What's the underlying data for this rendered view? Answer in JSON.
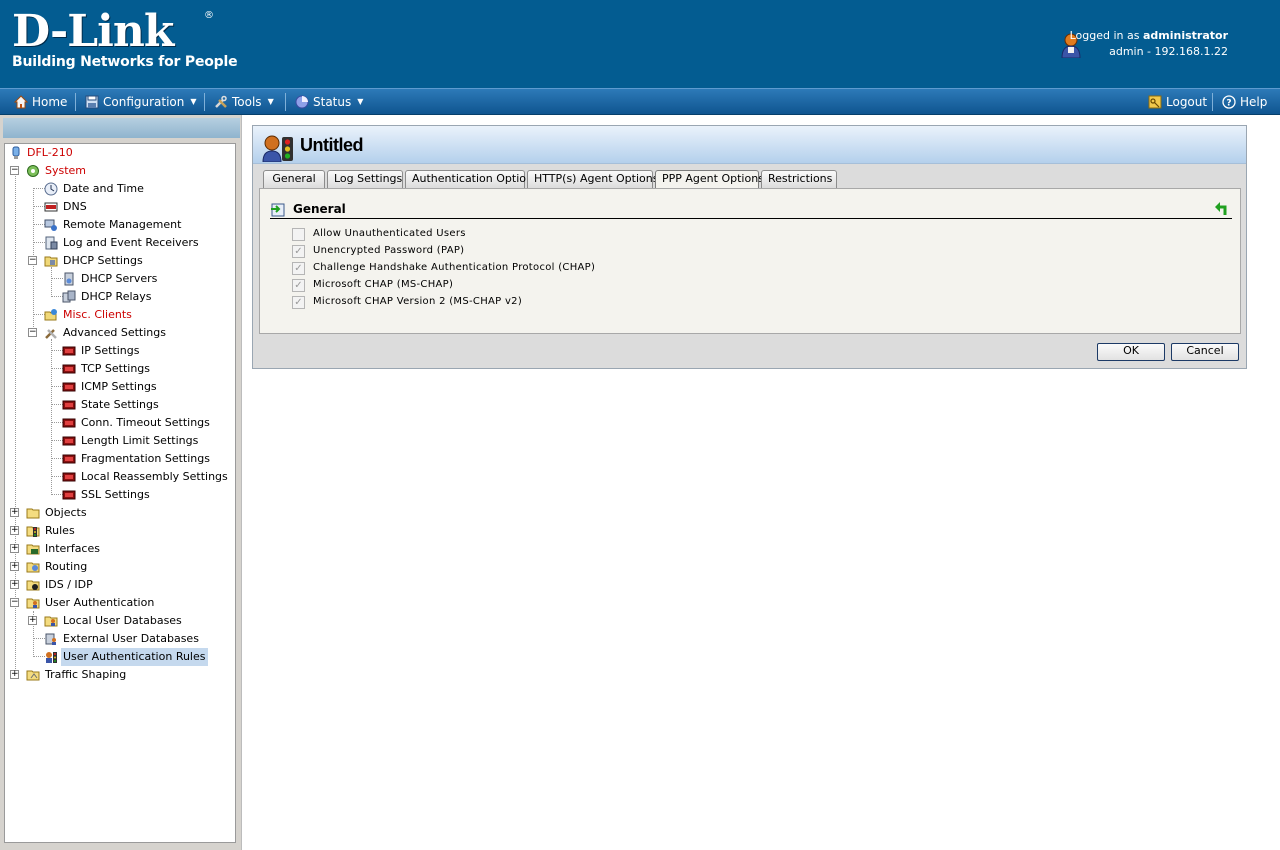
{
  "header": {
    "logo_text": "D-Link",
    "logo_reg": "®",
    "tagline": "Building Networks for People",
    "login_prefix": "Logged in as",
    "login_user": "administrator",
    "session": "admin - 192.168.1.22"
  },
  "menu": {
    "home": "Home",
    "configuration": "Configuration",
    "tools": "Tools",
    "status": "Status",
    "logout": "Logout",
    "help": "Help",
    "caret": "▼"
  },
  "tree": {
    "device": "DFL-210",
    "system": "System",
    "date_time": "Date and Time",
    "dns": "DNS",
    "remote_mgmt": "Remote Management",
    "log_receivers": "Log and Event Receivers",
    "dhcp_settings": "DHCP Settings",
    "dhcp_servers": "DHCP Servers",
    "dhcp_relays": "DHCP Relays",
    "misc_clients": "Misc. Clients",
    "advanced_settings": "Advanced Settings",
    "ip_settings": "IP Settings",
    "tcp_settings": "TCP Settings",
    "icmp_settings": "ICMP Settings",
    "state_settings": "State Settings",
    "conn_timeout": "Conn. Timeout Settings",
    "length_limit": "Length Limit Settings",
    "fragmentation": "Fragmentation Settings",
    "local_reassembly": "Local Reassembly Settings",
    "ssl_settings": "SSL Settings",
    "objects": "Objects",
    "rules": "Rules",
    "interfaces": "Interfaces",
    "routing": "Routing",
    "ids_idp": "IDS / IDP",
    "user_auth": "User Authentication",
    "local_user_db": "Local User Databases",
    "external_user_db": "External User Databases",
    "user_auth_rules": "User Authentication Rules",
    "traffic_shaping": "Traffic Shaping",
    "plus": "+",
    "minus": "−"
  },
  "page": {
    "title": "Untitled",
    "tabs": [
      "General",
      "Log Settings",
      "Authentication Options",
      "HTTP(s) Agent Options",
      "PPP Agent Options",
      "Restrictions"
    ],
    "active_tab": "PPP Agent Options",
    "section_title": "General",
    "options": [
      {
        "label": "Allow Unauthenticated Users",
        "checked": false,
        "mark": ""
      },
      {
        "label": "Unencrypted Password (PAP)",
        "checked": true,
        "mark": "✓"
      },
      {
        "label": "Challenge Handshake Authentication Protocol (CHAP)",
        "checked": true,
        "mark": "✓"
      },
      {
        "label": "Microsoft CHAP (MS-CHAP)",
        "checked": true,
        "mark": "✓"
      },
      {
        "label": "Microsoft CHAP Version 2 (MS-CHAP v2)",
        "checked": true,
        "mark": "✓"
      }
    ],
    "ok_label": "OK",
    "cancel_label": "Cancel"
  },
  "colors": {
    "header_bg": "#035c91",
    "menubar": "#1a63a0",
    "red_text": "#cc0000",
    "selection": "#c5d9ee"
  }
}
